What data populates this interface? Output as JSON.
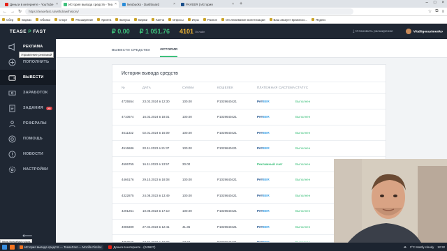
{
  "browser": {
    "tabs": [
      {
        "title": "Деньги в интернете - YouTube",
        "color": "#e62117",
        "active": false
      },
      {
        "title": "История вывода средств - Tea",
        "color": "#3ec07c",
        "active": true
      },
      {
        "title": "Neobucks - Dashboard",
        "color": "#2b8cd8",
        "active": false
      },
      {
        "title": "PAYEER | История",
        "color": "#1b4f8a",
        "active": false
      }
    ],
    "url": "https://teasefast.ru/withdraw/history/",
    "bookmarks": [
      "Сбер",
      "Баркас",
      "Облако",
      "Спорт",
      "Расширение",
      "Крипта",
      "Бонусы",
      "Биржи",
      "Капча",
      "Опросы",
      "Игры",
      "Разное",
      "Отслеживание монетизации",
      "Ваш аккаунт вражеско...",
      "Яндекс"
    ]
  },
  "header": {
    "logo_left": "TEASE",
    "logo_p": "P",
    "logo_right": "FAST",
    "balance_rub": "₽ 0.00",
    "balance_ad": "₽ 1 051.76",
    "online_count": "4101",
    "online_label": "Онлайн",
    "install_ext": "Установить расширение",
    "username": "Vitaliigerasimenko"
  },
  "sidebar": {
    "items": [
      {
        "label": "РЕКЛАМА",
        "icon": "megaphone-icon",
        "active": false
      },
      {
        "label": "ПОПОЛНИТЬ",
        "icon": "plus-circle-icon",
        "active": false
      },
      {
        "label": "ВЫВЕСТИ",
        "icon": "wallet-icon",
        "active": true
      },
      {
        "label": "ЗАРАБОТОК",
        "icon": "money-icon",
        "active": false
      },
      {
        "label": "ЗАДАНИЯ",
        "icon": "tasks-icon",
        "active": false,
        "badge": "25"
      },
      {
        "label": "РЕФЕРАЛЫ",
        "icon": "users-icon",
        "active": false
      },
      {
        "label": "ПОМОЩЬ",
        "icon": "help-icon",
        "active": false
      },
      {
        "label": "НОВОСТИ",
        "icon": "news-icon",
        "active": false
      },
      {
        "label": "НАСТРОЙКИ",
        "icon": "gear-icon",
        "active": false
      }
    ],
    "tooltip": "Управление рекламой"
  },
  "subtabs": [
    "ВЫВЕСТИ СРЕДСТВА",
    "ИСТОРИЯ"
  ],
  "card": {
    "title": "История вывода средств",
    "columns": [
      "№",
      "ДАТА",
      "СУММА",
      "КОШЕЛЕК",
      "ПЛАТЕЖНАЯ СИСТЕМА",
      "СТАТУС"
    ],
    "rows": [
      {
        "id": "4725554",
        "date": "23.02.2024 в 12:30",
        "amount": "100.00",
        "wallet": "P1029640421",
        "system": "PAYEER",
        "status": "Выполнен"
      },
      {
        "id": "4710674",
        "date": "16.02.2024 в 18:01",
        "amount": "100.00",
        "wallet": "P1029640421",
        "system": "PAYEER",
        "status": "Выполнен"
      },
      {
        "id": "4611332",
        "date": "02.01.2024 в 16:09",
        "amount": "100.00",
        "wallet": "P1029640421",
        "system": "PAYEER",
        "status": "Выполнен"
      },
      {
        "id": "4516686",
        "date": "20.11.2023 в 21:37",
        "amount": "100.00",
        "wallet": "P1029640421",
        "system": "PAYEER",
        "status": "Выполнен"
      },
      {
        "id": "4506755",
        "date": "16.11.2023 в 13:57",
        "amount": "30.00",
        "wallet": "",
        "system": "Рекламный счет",
        "status": "Выполнен"
      },
      {
        "id": "4466176",
        "date": "29.10.2023 в 18:08",
        "amount": "100.00",
        "wallet": "P1029640421",
        "system": "PAYEER",
        "status": "Выполнен"
      },
      {
        "id": "4322875",
        "date": "24.08.2023 в 13:49",
        "amount": "100.00",
        "wallet": "P1029640421",
        "system": "PAYEER",
        "status": "Выполнен"
      },
      {
        "id": "4291251",
        "date": "10.08.2023 в 17:10",
        "amount": "100.00",
        "wallet": "P1029640421",
        "system": "PAYEER",
        "status": "Выполнен"
      },
      {
        "id": "4086309",
        "date": "27.04.2023 в 12:41",
        "amount": "41.35",
        "wallet": "P1029640421",
        "system": "PAYEER",
        "status": "Выполнен"
      },
      {
        "id": "4052565",
        "date": "13.04.2023 в 18:29",
        "amount": "17.60",
        "wallet": "P1029640421",
        "system": "PAYEER",
        "status": "Выполнен"
      }
    ]
  },
  "taskbar": {
    "app1": "История вывода средств — TeaseFast — Mozilla Firefox",
    "app2": "Деньги в интернете - (245627)",
    "weather": "3°C Mostly cloudy",
    "time": "12:32"
  },
  "status_url": "https://teasefast.ru/ads"
}
